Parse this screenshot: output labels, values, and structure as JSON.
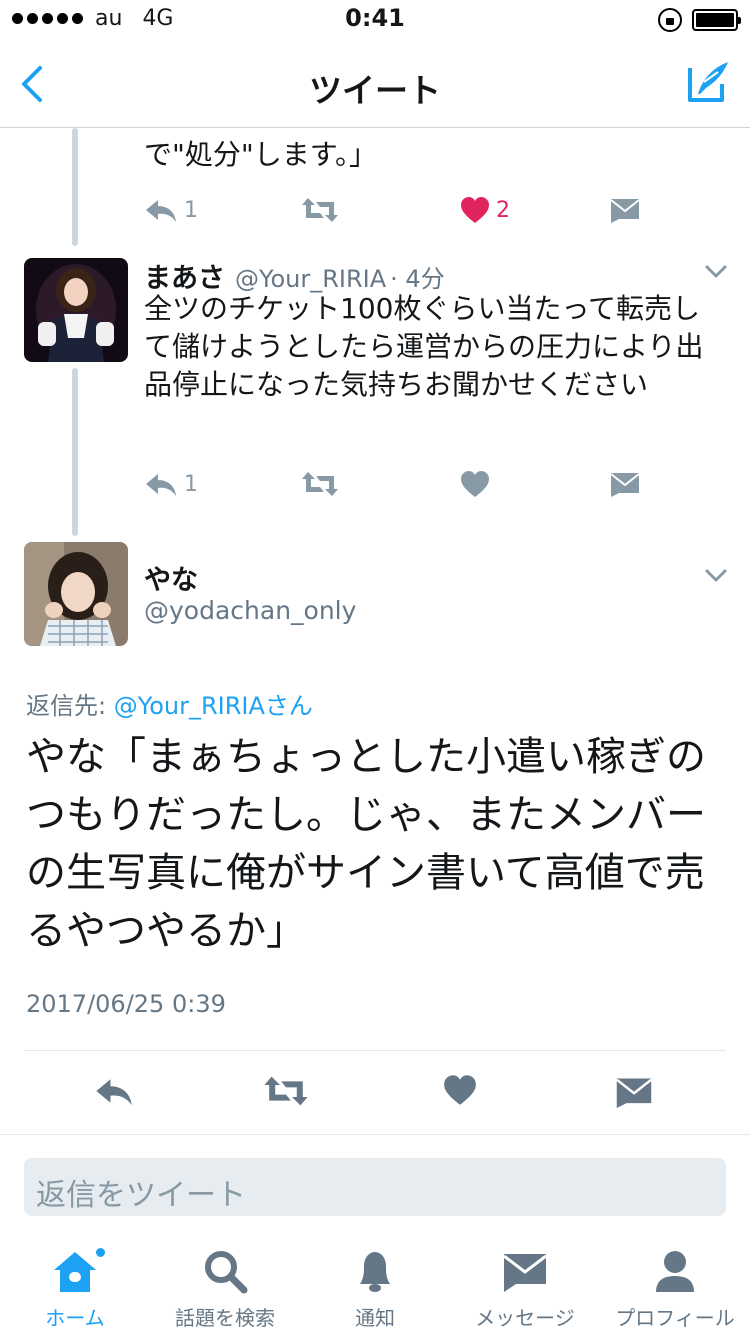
{
  "status_bar": {
    "carrier": "au",
    "network": "4G",
    "time": "0:41"
  },
  "nav": {
    "title": "ツイート"
  },
  "tweet1": {
    "text_tail": "で\"処分\"します。」",
    "reply_count": "1",
    "like_count": "2"
  },
  "tweet2": {
    "name": "まあさ",
    "handle": "@Your_RIRIA",
    "time": "· 4分",
    "text": "全ツのチケット100枚ぐらい当たって転売して儲けようとしたら運営からの圧力により出品停止になった気持ちお聞かせください",
    "reply_count": "1"
  },
  "main_tweet": {
    "name": "やな",
    "handle": "@yodachan_only",
    "reply_to_label": "返信先:",
    "reply_to_mention": "@Your_RIRIAさん",
    "text": "やな「まぁちょっとした小遣い稼ぎのつもりだったし。じゃ、またメンバーの生写真に俺がサイン書いて高値で売るやつやるか」",
    "timestamp": "2017/06/25 0:39"
  },
  "reply_input": {
    "placeholder": "返信をツイート"
  },
  "tabs": [
    {
      "label": "ホーム",
      "icon": "home-icon"
    },
    {
      "label": "話題を検索",
      "icon": "search-icon"
    },
    {
      "label": "通知",
      "icon": "bell-icon"
    },
    {
      "label": "メッセージ",
      "icon": "mail-icon"
    },
    {
      "label": "プロフィール",
      "icon": "profile-icon"
    }
  ],
  "colors": {
    "accent": "#1da1f2",
    "like": "#e0245e",
    "icon_gray": "#8899a6",
    "text": "#14171a"
  }
}
